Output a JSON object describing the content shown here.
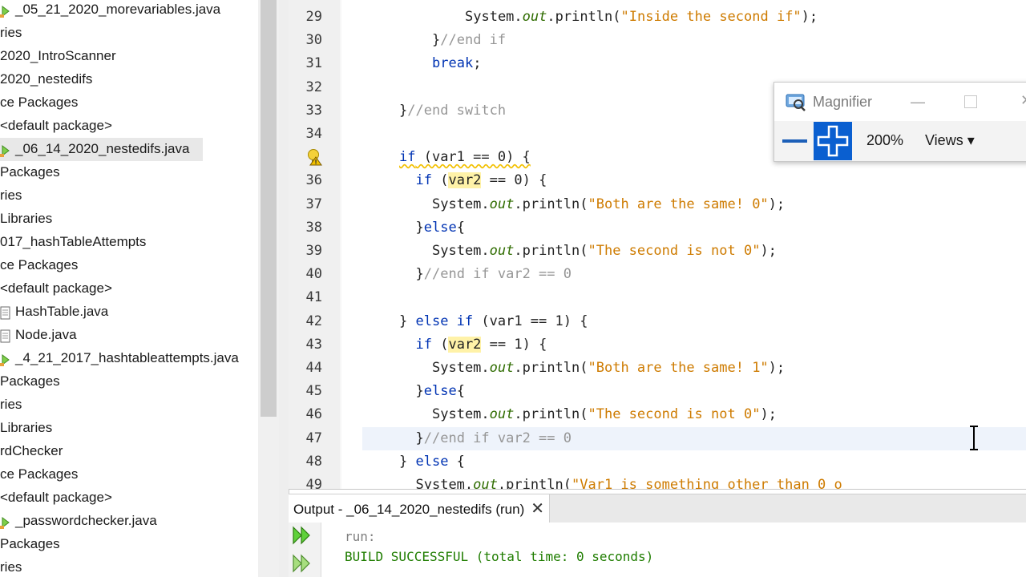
{
  "project_tree": {
    "items": [
      {
        "label": "_05_21_2020_morevariables.java",
        "icon": "java-file-icon",
        "indent": 0
      },
      {
        "label": "ries",
        "icon": "",
        "indent": 0
      },
      {
        "label": "2020_IntroScanner",
        "icon": "",
        "indent": 0
      },
      {
        "label": "2020_nestedifs",
        "icon": "",
        "indent": 0
      },
      {
        "label": "ce Packages",
        "icon": "",
        "indent": 0
      },
      {
        "label": "<default package>",
        "icon": "",
        "indent": 0
      },
      {
        "label": "_06_14_2020_nestedifs.java",
        "icon": "java-file-icon",
        "selected": true
      },
      {
        "label": "Packages",
        "icon": "",
        "indent": 0
      },
      {
        "label": "ries",
        "icon": "",
        "indent": 0
      },
      {
        "label": "Libraries",
        "icon": "",
        "indent": 0
      },
      {
        "label": "017_hashTableAttempts",
        "icon": "",
        "indent": 0
      },
      {
        "label": "ce Packages",
        "icon": "",
        "indent": 0
      },
      {
        "label": "<default package>",
        "icon": "",
        "indent": 0
      },
      {
        "label": "HashTable.java",
        "icon": "doc-file-icon"
      },
      {
        "label": "Node.java",
        "icon": "doc-file-icon"
      },
      {
        "label": "_4_21_2017_hashtableattempts.java",
        "icon": "java-file-icon"
      },
      {
        "label": "Packages",
        "icon": "",
        "indent": 0
      },
      {
        "label": "ries",
        "icon": "",
        "indent": 0
      },
      {
        "label": "Libraries",
        "icon": "",
        "indent": 0
      },
      {
        "label": "rdChecker",
        "icon": "",
        "indent": 0
      },
      {
        "label": "ce Packages",
        "icon": "",
        "indent": 0
      },
      {
        "label": "<default package>",
        "icon": "",
        "indent": 0
      },
      {
        "label": "_passwordchecker.java",
        "icon": "java-file-icon"
      },
      {
        "label": "Packages",
        "icon": "",
        "indent": 0
      },
      {
        "label": "ries",
        "icon": "",
        "indent": 0
      }
    ]
  },
  "editor": {
    "lines": [
      {
        "n": "29",
        "ind": 12,
        "parts": [
          [
            "",
            "System."
          ],
          [
            "it",
            "out"
          ],
          [
            "",
            ".println("
          ],
          [
            "st",
            "\"Inside the second if\""
          ],
          [
            "",
            ");"
          ]
        ]
      },
      {
        "n": "30",
        "ind": 8,
        "parts": [
          [
            "",
            "}"
          ],
          [
            "cm",
            "//end if"
          ]
        ]
      },
      {
        "n": "31",
        "ind": 8,
        "parts": [
          [
            "kw",
            "break"
          ],
          [
            "",
            ";"
          ]
        ]
      },
      {
        "n": "32",
        "ind": 0,
        "parts": []
      },
      {
        "n": "33",
        "ind": 4,
        "parts": [
          [
            "",
            "}"
          ],
          [
            "cm",
            "//end switch"
          ]
        ]
      },
      {
        "n": "34",
        "ind": 0,
        "parts": []
      },
      {
        "n": "",
        "ind": 4,
        "parts": [
          [
            "kw uline",
            "if"
          ],
          [
            "uline",
            " (var1 == 0) {"
          ]
        ]
      },
      {
        "n": "36",
        "ind": 6,
        "parts": [
          [
            "kw",
            "if"
          ],
          [
            "",
            " ("
          ],
          [
            "hl",
            "var2"
          ],
          [
            "",
            " == 0) {"
          ]
        ]
      },
      {
        "n": "37",
        "ind": 8,
        "parts": [
          [
            "",
            "System."
          ],
          [
            "it",
            "out"
          ],
          [
            "",
            ".println("
          ],
          [
            "st",
            "\"Both are the same! 0\""
          ],
          [
            "",
            ");"
          ]
        ]
      },
      {
        "n": "38",
        "ind": 6,
        "parts": [
          [
            "",
            "}"
          ],
          [
            "kw",
            "else"
          ],
          [
            "",
            "{"
          ]
        ]
      },
      {
        "n": "39",
        "ind": 8,
        "parts": [
          [
            "",
            "System."
          ],
          [
            "it",
            "out"
          ],
          [
            "",
            ".println("
          ],
          [
            "st",
            "\"The second is not 0\""
          ],
          [
            "",
            ");"
          ]
        ]
      },
      {
        "n": "40",
        "ind": 6,
        "parts": [
          [
            "",
            "}"
          ],
          [
            "cm",
            "//end if var2 == 0"
          ]
        ]
      },
      {
        "n": "41",
        "ind": 0,
        "parts": []
      },
      {
        "n": "42",
        "ind": 4,
        "parts": [
          [
            "",
            "} "
          ],
          [
            "kw",
            "else if"
          ],
          [
            "",
            " (var1 == 1) {"
          ]
        ]
      },
      {
        "n": "43",
        "ind": 6,
        "parts": [
          [
            "kw",
            "if"
          ],
          [
            "",
            " ("
          ],
          [
            "hl",
            "var2"
          ],
          [
            "",
            " == 1) {"
          ]
        ]
      },
      {
        "n": "44",
        "ind": 8,
        "parts": [
          [
            "",
            "System."
          ],
          [
            "it",
            "out"
          ],
          [
            "",
            ".println("
          ],
          [
            "st",
            "\"Both are the same! 1\""
          ],
          [
            "",
            ");"
          ]
        ]
      },
      {
        "n": "45",
        "ind": 6,
        "parts": [
          [
            "",
            "}"
          ],
          [
            "kw",
            "else"
          ],
          [
            "",
            "{"
          ]
        ]
      },
      {
        "n": "46",
        "ind": 8,
        "parts": [
          [
            "",
            "System."
          ],
          [
            "it",
            "out"
          ],
          [
            "",
            ".println("
          ],
          [
            "st",
            "\"The second is not 0\""
          ],
          [
            "",
            ");"
          ]
        ]
      },
      {
        "n": "47",
        "ind": 6,
        "parts": [
          [
            "",
            "}"
          ],
          [
            "cm",
            "//end if var2 == 0"
          ]
        ]
      },
      {
        "n": "48",
        "ind": 4,
        "parts": [
          [
            "",
            "} "
          ],
          [
            "kw",
            "else"
          ],
          [
            "",
            " {"
          ]
        ]
      },
      {
        "n": "49",
        "ind": 6,
        "parts": [
          [
            "",
            "System."
          ],
          [
            "it",
            "out"
          ],
          [
            "",
            ".println("
          ],
          [
            "st",
            "\"Var1 is something other than 0 o"
          ]
        ]
      }
    ]
  },
  "magnifier": {
    "title": "Magnifier",
    "minimize": "—",
    "close": "✕",
    "zoom": "200%",
    "views_label": "Views ▾"
  },
  "output": {
    "tab_label": "Output - _06_14_2020_nestedifs (run)",
    "close": "✕",
    "lines": [
      "run:",
      "BUILD SUCCESSFUL (total time: 0 seconds)"
    ]
  },
  "colors": {
    "keyword": "#0033b3",
    "string": "#ce7b00",
    "comment": "#969696",
    "success": "#1f7d00",
    "accent": "#0a5fd0"
  }
}
